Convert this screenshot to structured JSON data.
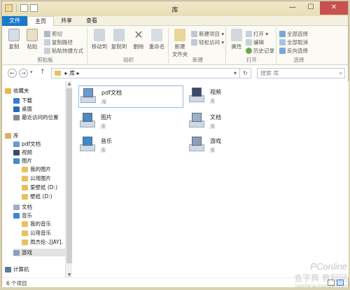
{
  "window": {
    "title": "库",
    "controls": {
      "minimize": "—",
      "maximize": "☐",
      "close": "✕"
    }
  },
  "ribbon": {
    "tabs": [
      "文件",
      "主页",
      "共享",
      "查看"
    ],
    "groups": {
      "clipboard": {
        "label": "剪贴板",
        "copy": "复制",
        "paste": "粘贴",
        "cut": "剪切",
        "copy_path": "复制路径",
        "paste_shortcut": "粘贴快捷方式"
      },
      "organize": {
        "label": "组织",
        "move_to": "移动到",
        "copy_to": "复制到",
        "delete": "删除",
        "rename": "重命名"
      },
      "new": {
        "label": "新建",
        "new_folder": "新建\n文件夹",
        "new_item": "新建项目 ▾",
        "easy_access": "轻松访问 ▾"
      },
      "open": {
        "label": "打开",
        "properties": "属性",
        "open": "打开 ▾",
        "edit": "编辑",
        "history": "历史记录"
      },
      "select": {
        "label": "选择",
        "select_all": "全部选择",
        "select_none": "全部取消",
        "invert": "反向选择"
      }
    }
  },
  "address": {
    "back": "←",
    "forward": "→",
    "recent": "▾",
    "up": "↑",
    "path": "▸ 库 ▸",
    "dropdown": "▾",
    "refresh": "↻",
    "search_placeholder": "搜索 库",
    "search_icon": "search-icon"
  },
  "navpane": {
    "items": [
      {
        "label": "收藏夹",
        "color": "#e8b84a",
        "level": 0
      },
      {
        "label": "下载",
        "color": "#3a7bd5",
        "level": 1
      },
      {
        "label": "桌面",
        "color": "#2a6ab5",
        "level": 1
      },
      {
        "label": "最近访问的位置",
        "color": "#8a8a8a",
        "level": 1
      },
      {
        "label": "库",
        "color": "#d8b060",
        "level": 0
      },
      {
        "label": "pdf文档",
        "color": "#6a9bd0",
        "level": 1
      },
      {
        "label": "视频",
        "color": "#3a4a6a",
        "level": 1
      },
      {
        "label": "图片",
        "color": "#4a8ac0",
        "level": 1
      },
      {
        "label": "我的图片",
        "color": "#e8c060",
        "level": 2
      },
      {
        "label": "公用图片",
        "color": "#e8c060",
        "level": 2
      },
      {
        "label": "爱壁纸 (D:)",
        "color": "#e8c060",
        "level": 2
      },
      {
        "label": "壁纸 (D:)",
        "color": "#e8c060",
        "level": 2
      },
      {
        "label": "文档",
        "color": "#9ab0c8",
        "level": 1
      },
      {
        "label": "音乐",
        "color": "#3a8ad0",
        "level": 1
      },
      {
        "label": "我的音乐",
        "color": "#e8c060",
        "level": 2
      },
      {
        "label": "公用音乐",
        "color": "#e8c060",
        "level": 2
      },
      {
        "label": "周杰伦-.[JAY].",
        "color": "#e8c060",
        "level": 2
      },
      {
        "label": "游戏",
        "color": "#8aa0b8",
        "level": 1,
        "selected": true
      },
      {
        "label": "计算机",
        "color": "#5a7a9a",
        "level": 0
      }
    ]
  },
  "libraries": [
    {
      "name": "pdf文档",
      "type": "库",
      "color": "#6a9bd0",
      "selected": true
    },
    {
      "name": "视频",
      "type": "库",
      "color": "#3a4a6a"
    },
    {
      "name": "图片",
      "type": "库",
      "color": "#4a8ac0"
    },
    {
      "name": "文档",
      "type": "库",
      "color": "#9ab0c8"
    },
    {
      "name": "音乐",
      "type": "库",
      "color": "#3a8ad0"
    },
    {
      "name": "游戏",
      "type": "库",
      "color": "#8aa0b8"
    }
  ],
  "status": {
    "count_text": "6 个项目"
  },
  "watermark": {
    "brand": "PConline",
    "cn": "查字典 教程网",
    "url": "jiaocheng.chazidian.com"
  }
}
